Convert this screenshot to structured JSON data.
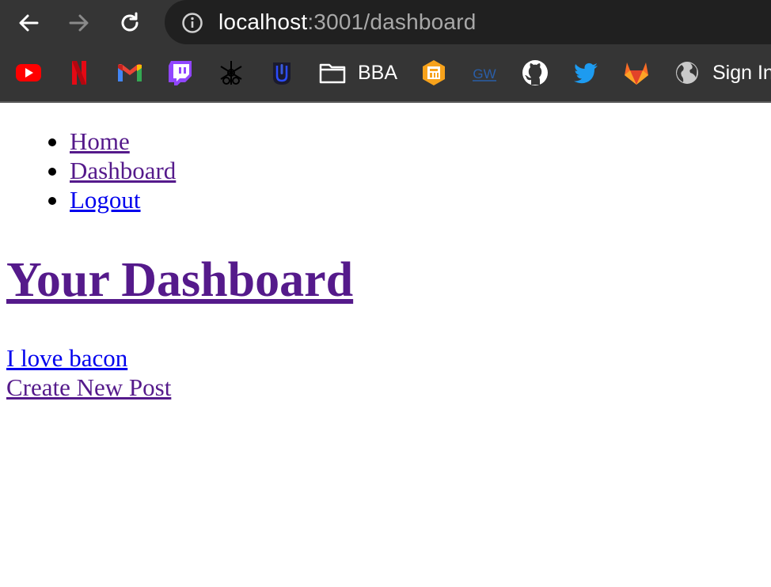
{
  "browser": {
    "url_host": "localhost",
    "url_path": ":3001/dashboard",
    "bookmarks": [
      {
        "icon": "youtube-icon",
        "color": "#ff0000"
      },
      {
        "icon": "netflix-icon",
        "color": "#e50914"
      },
      {
        "icon": "gmail-icon",
        "color": "#ea4335"
      },
      {
        "icon": "twitch-icon",
        "color": "#9146ff"
      },
      {
        "icon": "snowflake-bike-icon",
        "color": "#000000"
      },
      {
        "icon": "shield-u-icon",
        "color": "#3b5bdb"
      },
      {
        "icon": "folder-icon",
        "label": "BBA"
      },
      {
        "icon": "orange-app-icon",
        "color": "#f7a21b"
      },
      {
        "icon": "gw-icon",
        "color": "#1d4f91"
      },
      {
        "icon": "github-icon",
        "color": "#ffffff"
      },
      {
        "icon": "twitter-icon",
        "color": "#1d9bf0"
      },
      {
        "icon": "gitlab-icon",
        "color": "#fc6d26"
      },
      {
        "icon": "globe-icon",
        "label": "Sign In"
      }
    ]
  },
  "nav": {
    "items": [
      "Home",
      "Dashboard",
      "Logout"
    ]
  },
  "page": {
    "title": "Your Dashboard",
    "posts": [
      "I love bacon"
    ],
    "create_link": "Create New Post"
  },
  "colors": {
    "link_visited": "#551a8b",
    "link_unvisited": "#0000ee",
    "chrome_bg": "#353535",
    "omnibox_bg": "#202020"
  }
}
